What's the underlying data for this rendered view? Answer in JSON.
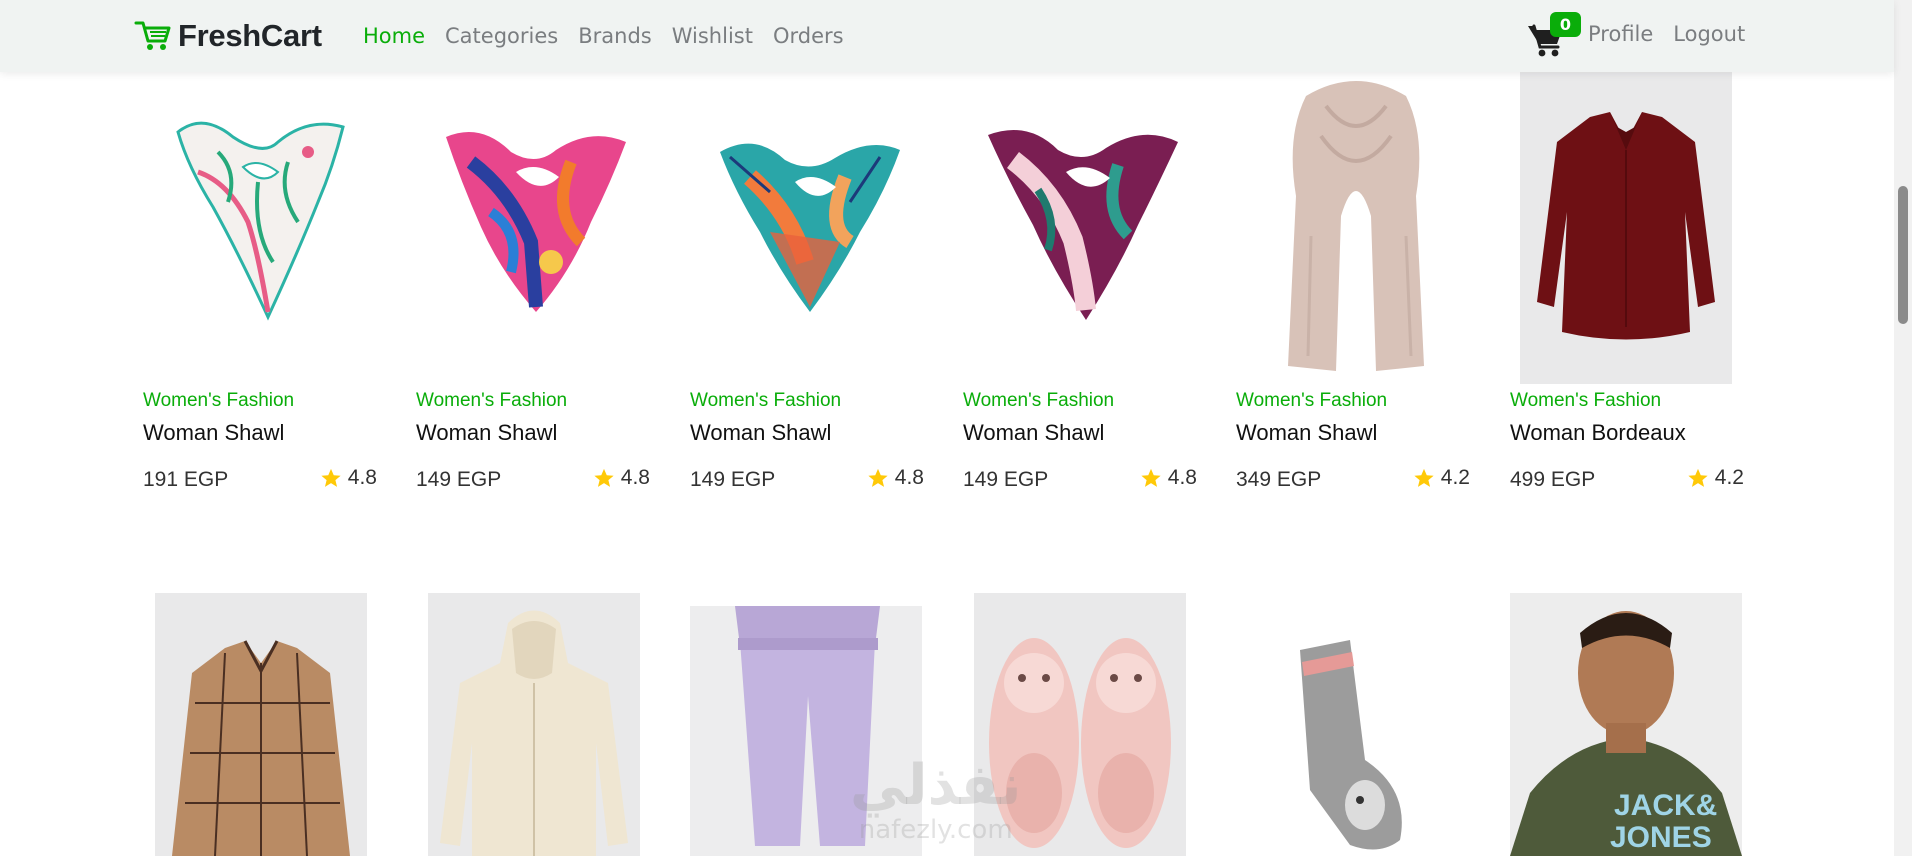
{
  "brand": {
    "name": "FreshCart",
    "icon": "cart-logo-icon"
  },
  "nav": {
    "links": [
      "Home",
      "Categories",
      "Brands",
      "Wishlist",
      "Orders"
    ],
    "active": "Home",
    "cart_count": "0",
    "profile": "Profile",
    "logout": "Logout"
  },
  "colors": {
    "accent": "#0aad0a",
    "star": "#ffc908",
    "navbar_bg": "#f0f3f2"
  },
  "products": [
    {
      "category": "Women's Fashion",
      "name": "Woman Shawl",
      "price": "191 EGP",
      "rating": "4.8",
      "image": "white-green-pink-scarf"
    },
    {
      "category": "Women's Fashion",
      "name": "Woman Shawl",
      "price": "149 EGP",
      "rating": "4.8",
      "image": "blue-pink-scarf"
    },
    {
      "category": "Women's Fashion",
      "name": "Woman Shawl",
      "price": "149 EGP",
      "rating": "4.8",
      "image": "orange-teal-scarf"
    },
    {
      "category": "Women's Fashion",
      "name": "Woman Shawl",
      "price": "149 EGP",
      "rating": "4.8",
      "image": "purple-floral-scarf"
    },
    {
      "category": "Women's Fashion",
      "name": "Woman Shawl",
      "price": "349 EGP",
      "rating": "4.2",
      "image": "beige-long-scarf"
    },
    {
      "category": "Women's Fashion",
      "name": "Woman Bordeaux",
      "price": "499 EGP",
      "rating": "4.2",
      "image": "bordeaux-blouse"
    }
  ],
  "second_row_images": [
    "plaid-shirt",
    "cream-hoodie",
    "lilac-joggers",
    "pink-slippers",
    "grey-sock",
    "jack-jones-tshirt"
  ],
  "tshirt_print": [
    "JACK&",
    "JONES"
  ],
  "watermark": {
    "arabic": "نفذلي",
    "latin": "nafezly.com"
  }
}
